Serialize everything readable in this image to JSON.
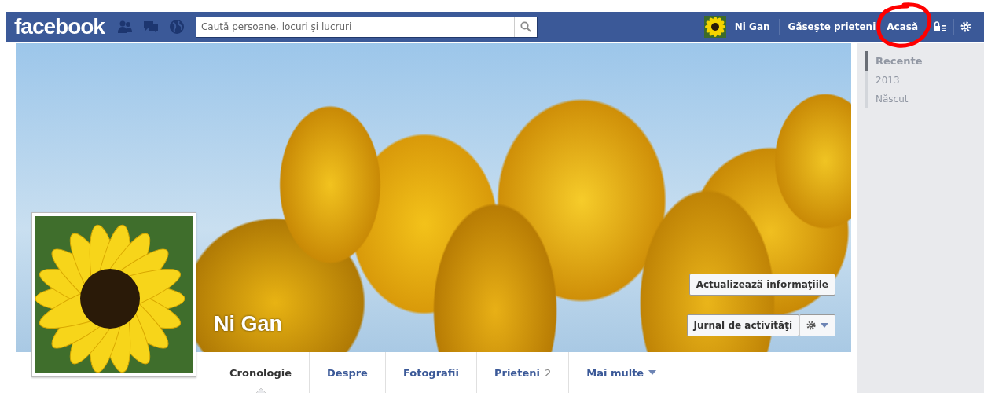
{
  "top_bar": {
    "logo": "facebook",
    "search": {
      "placeholder": "Caută persoane, locuri şi lucruri"
    },
    "user_name": "Ni Gan",
    "links": [
      {
        "label": "Găseşte prieteni"
      },
      {
        "label": "Acasă"
      }
    ]
  },
  "profile": {
    "name": "Ni Gan",
    "buttons": [
      {
        "label": "Actualizează informaţiile"
      },
      {
        "label": "Jurnal de activităţi"
      }
    ]
  },
  "tabs": [
    {
      "label": "Cronologie",
      "selected": true
    },
    {
      "label": "Despre",
      "selected": false
    },
    {
      "label": "Fotografii",
      "selected": false
    },
    {
      "label": "Prieteni",
      "count": "2",
      "selected": false
    },
    {
      "label": "Mai multe",
      "dropdown": true,
      "selected": false
    }
  ],
  "timeline": [
    {
      "label": "Recente",
      "selected": true
    },
    {
      "label": "2013",
      "selected": false
    },
    {
      "label": "Născut",
      "selected": false
    }
  ]
}
